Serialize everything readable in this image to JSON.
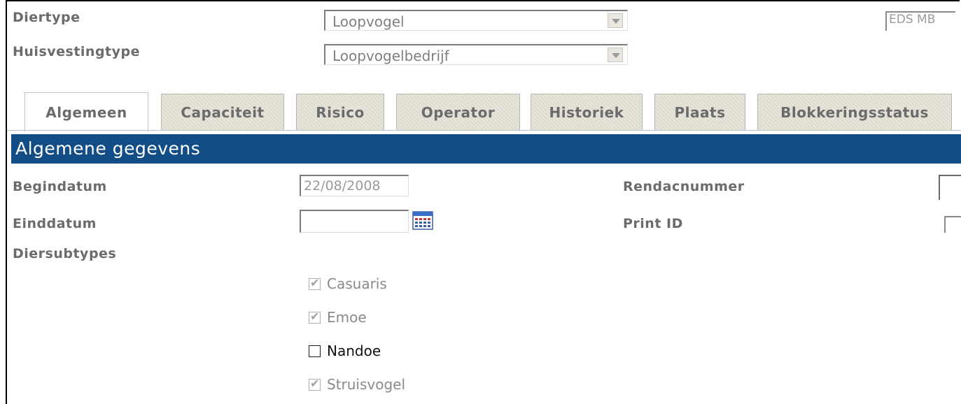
{
  "top": {
    "diertype_label": "Diertype",
    "diertype_value": "Loopvogel",
    "huisvestingtype_label": "Huisvestingtype",
    "huisvestingtype_value": "Loopvogelbedrijf",
    "eds_value": "EDS MB"
  },
  "tabs": [
    {
      "label": "Algemeen",
      "active": true
    },
    {
      "label": "Capaciteit",
      "active": false
    },
    {
      "label": "Risico",
      "active": false
    },
    {
      "label": "Operator",
      "active": false
    },
    {
      "label": "Historiek",
      "active": false
    },
    {
      "label": "Plaats",
      "active": false
    },
    {
      "label": "Blokkeringsstatus",
      "active": false
    }
  ],
  "section": {
    "title": "Algemene gegevens"
  },
  "fields": {
    "begindatum_label": "Begindatum",
    "begindatum_value": "22/08/2008",
    "einddatum_label": "Einddatum",
    "einddatum_value": "",
    "diersubtypes_label": "Diersubtypes",
    "rendacnummer_label": "Rendacnummer",
    "printid_label": "Print ID"
  },
  "subtypes": [
    {
      "label": "Casuaris",
      "checked": true,
      "disabled": true
    },
    {
      "label": "Emoe",
      "checked": true,
      "disabled": true
    },
    {
      "label": "Nandoe",
      "checked": false,
      "disabled": false
    },
    {
      "label": "Struisvogel",
      "checked": true,
      "disabled": true
    }
  ],
  "icons": {
    "dropdown": "chevron-down-icon",
    "calendar": "calendar-icon",
    "checkmark": "checkmark-icon"
  },
  "colors": {
    "header_bg": "#134d87",
    "label_gray": "#6b6b6b"
  }
}
